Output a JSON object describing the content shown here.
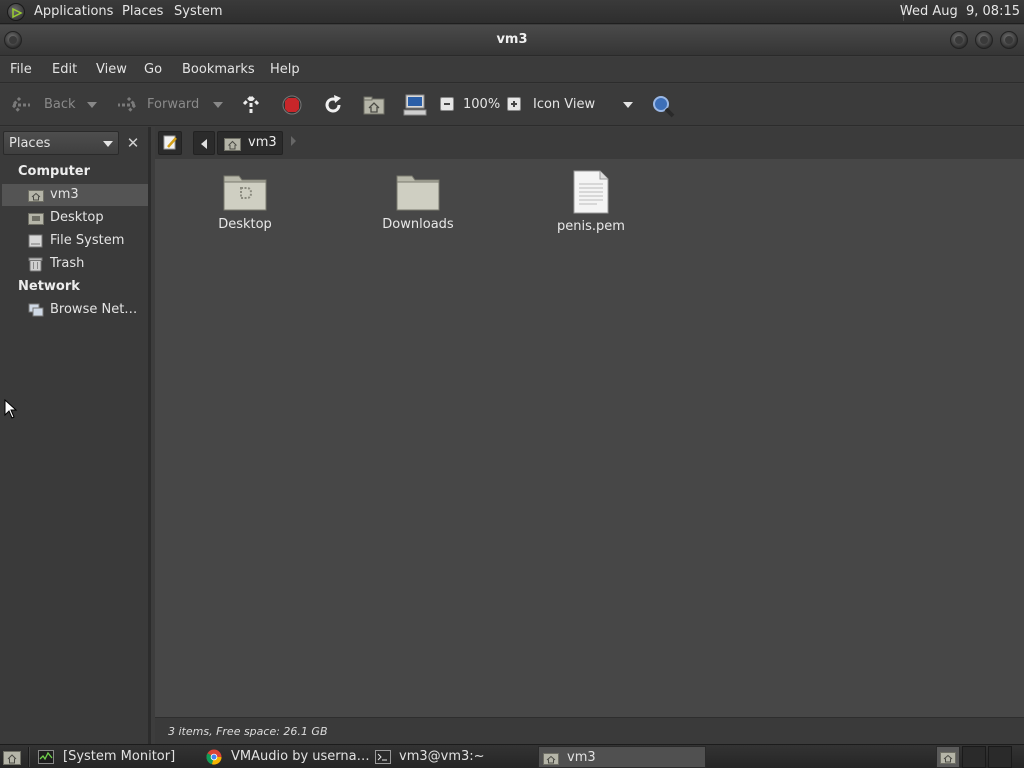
{
  "top_panel": {
    "menus": [
      "Applications",
      "Places",
      "System"
    ],
    "clock": "Wed Aug  9, 08:15"
  },
  "window": {
    "title": "vm3"
  },
  "menubar": [
    "File",
    "Edit",
    "View",
    "Go",
    "Bookmarks",
    "Help"
  ],
  "toolbar": {
    "back_label": "Back",
    "forward_label": "Forward",
    "zoom_level": "100%",
    "view_mode": "Icon View"
  },
  "sidebar": {
    "selector_label": "Places",
    "sections": [
      {
        "heading": "Computer",
        "items": [
          {
            "label": "vm3",
            "icon": "home-folder-icon",
            "selected": true
          },
          {
            "label": "Desktop",
            "icon": "desktop-folder-icon",
            "selected": false
          },
          {
            "label": "File System",
            "icon": "drive-icon",
            "selected": false
          },
          {
            "label": "Trash",
            "icon": "trash-icon",
            "selected": false
          }
        ]
      },
      {
        "heading": "Network",
        "items": [
          {
            "label": "Browse Net…",
            "icon": "network-icon",
            "selected": false
          }
        ]
      }
    ]
  },
  "location": {
    "crumbs": [
      "vm3"
    ]
  },
  "files": [
    {
      "name": "Desktop",
      "type": "folder",
      "icon": "desktop-folder-icon"
    },
    {
      "name": "Downloads",
      "type": "folder",
      "icon": "folder-icon"
    },
    {
      "name": "penis.pem",
      "type": "file",
      "icon": "document-icon"
    }
  ],
  "status": {
    "text": "3 items, Free space: 26.1 GB"
  },
  "taskbar": {
    "tasks": [
      {
        "label": "[System Monitor]",
        "icon": "system-monitor-icon",
        "active": false
      },
      {
        "label": "VMAudio by userna…",
        "icon": "chrome-icon",
        "active": false
      },
      {
        "label": "vm3@vm3:~",
        "icon": "terminal-icon",
        "active": false
      },
      {
        "label": "vm3",
        "icon": "home-folder-icon",
        "active": true
      }
    ]
  },
  "colors": {
    "panel_bg": "#2e2e2e",
    "window_bg": "#3b3b3b",
    "fileview_bg": "#474747",
    "folder_color": "#cfcfc2",
    "selection_bg": "#545454",
    "stop_red": "#c8262a"
  }
}
